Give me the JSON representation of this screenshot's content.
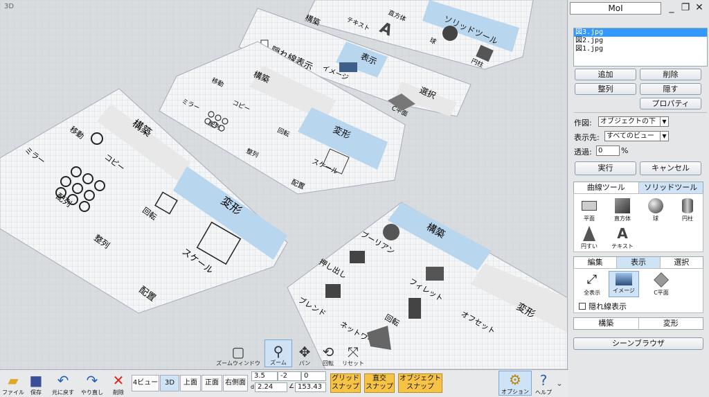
{
  "viewport": {
    "label": "3D",
    "controls": {
      "zoom_window": "ズームウィンドウ",
      "zoom": "ズーム",
      "pan": "パン",
      "rotate": "回転",
      "reset": "リセット"
    }
  },
  "panel": {
    "title": "MoI",
    "files": [
      "図3.jpg",
      "図2.jpg",
      "図1.jpg"
    ],
    "buttons": {
      "add": "追加",
      "delete": "削除",
      "align": "整列",
      "hide": "隠す",
      "properties": "プロパティ",
      "execute": "実行",
      "cancel": "キャンセル"
    },
    "draw_label": "作図:",
    "draw_value": "オブジェクトの下",
    "show_in_label": "表示先:",
    "show_in_value": "すべてのビュー",
    "transparency_label": "透過:",
    "transparency_value": "0",
    "percent": "%",
    "tool_tabs": [
      "曲線ツール",
      "ソリッドツール"
    ],
    "solid_tools": [
      "平面",
      "直方体",
      "球",
      "円柱",
      "円すい",
      "テキスト"
    ],
    "cat_tabs": [
      "編集",
      "表示",
      "選択"
    ],
    "view_tools": [
      "全表示",
      "イメージ",
      "C平面"
    ],
    "hidden_lines": "隠れ線表示",
    "construct": "構築",
    "transform": "変形",
    "scene_browser": "シーンブラウザ"
  },
  "bottom": {
    "file": "ファイル",
    "save": "保存",
    "undo": "元に戻す",
    "redo": "やり直し",
    "delete": "削除",
    "view_tabs": [
      "4ビュー",
      "3D",
      "上面",
      "正面",
      "右側面"
    ],
    "coord_x": "3.5",
    "coord_y": "-2",
    "coord_z": "0",
    "coord_d_label": "d",
    "coord_d": "2.24",
    "coord_angle_label": "∠",
    "coord_angle": "153.43",
    "grid_snap": [
      "グリッド",
      "スナップ"
    ],
    "ortho_snap": [
      "直交",
      "スナップ"
    ],
    "object_snap": [
      "オブジェクト",
      "スナップ"
    ],
    "options": "オプション",
    "help": "ヘルプ"
  },
  "scene": {
    "panel_a": {
      "construct": "構築",
      "transform": "変形",
      "move": "移動",
      "copy": "コピー",
      "mirror": "ミラー",
      "array": "配列",
      "rotate": "回転",
      "align": "整列",
      "scale": "スケール",
      "arrange": "配置"
    },
    "panel_b": {
      "construct": "構築",
      "transform": "変形",
      "move": "移動",
      "copy": "コピー",
      "mirror": "ミラー",
      "array": "配列",
      "rotate": "回転",
      "align": "整列",
      "scale": "スケール",
      "arrange": "配置"
    },
    "panel_c": {
      "construct": "構築",
      "display": "表示",
      "select": "選択",
      "all": "全表示",
      "hidden": "隠れ線表示",
      "image": "イメージ",
      "cplane": "C平面"
    },
    "panel_d": {
      "solid": "ソリッドツール",
      "box": "直方体",
      "text": "テキスト",
      "sphere": "球",
      "cylinder": "円柱",
      "plane": "平面"
    },
    "panel_e": {
      "construct": "構築",
      "transform": "変形",
      "boolean": "ブーリアン",
      "extrude": "押し出し",
      "fillet": "フィレット",
      "blend": "ブレンド",
      "rotate": "回転",
      "offset": "オフセット",
      "network": "ネットワーク"
    }
  }
}
